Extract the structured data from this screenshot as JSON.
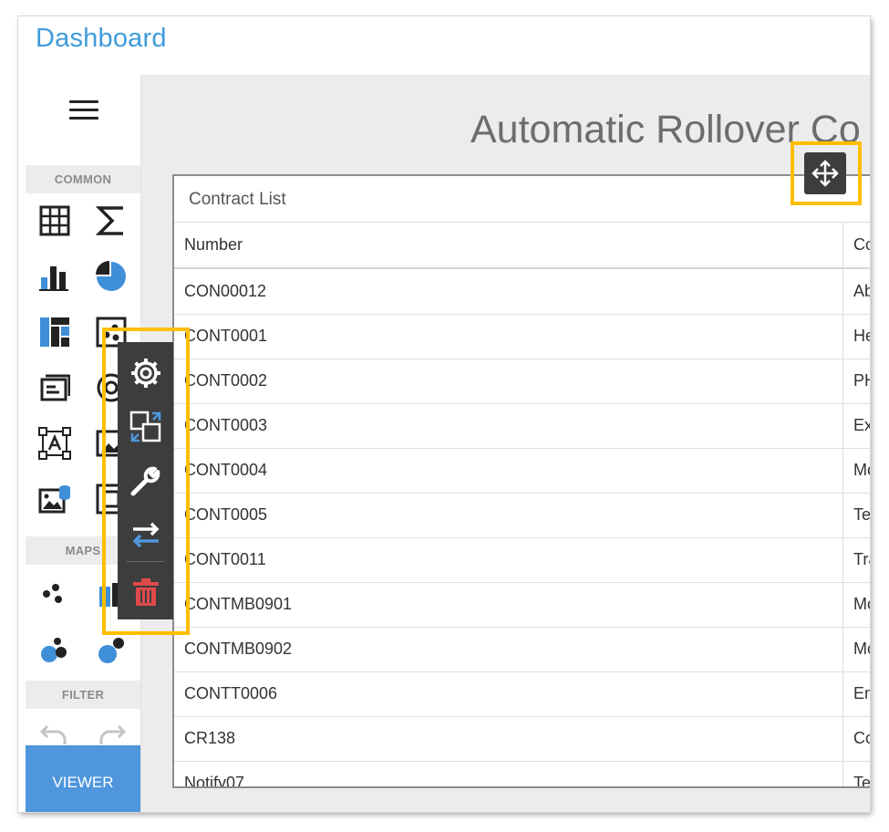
{
  "app": {
    "title": "Dashboard"
  },
  "sidebar": {
    "sections": [
      "COMMON",
      "MAPS",
      "FILTER"
    ],
    "viewer_label": "VIEWER",
    "tools": [
      "grid-icon",
      "sum-icon",
      "bar-chart-icon",
      "pie-chart-icon",
      "treemap-icon",
      "scatter-icon",
      "card-icon",
      "gauge-icon",
      "text-box-icon",
      "image-icon",
      "bound-image-icon",
      "frame-icon",
      "dot-map-icon",
      "choropleth-map-icon",
      "bubble-map-icon",
      "pie-map-icon"
    ]
  },
  "dashboard": {
    "title": "Automatic Rollover Co"
  },
  "grid": {
    "caption": "Contract List",
    "columns": [
      "Number",
      "Co"
    ],
    "rows": [
      {
        "number": "CON00012",
        "col2": "Ab"
      },
      {
        "number": "CONT0001",
        "col2": "He"
      },
      {
        "number": "CONT0002",
        "col2": "PH"
      },
      {
        "number": "CONT0003",
        "col2": "Ex"
      },
      {
        "number": "CONT0004",
        "col2": "Mc"
      },
      {
        "number": "CONT0005",
        "col2": "Te"
      },
      {
        "number": "CONT0011",
        "col2": "Tra"
      },
      {
        "number": "CONTMB0901",
        "col2": "Mc"
      },
      {
        "number": "CONTMB0902",
        "col2": "Mc"
      },
      {
        "number": "CONTT0006",
        "col2": "En"
      },
      {
        "number": "CR138",
        "col2": "Co"
      },
      {
        "number": "Notify07",
        "col2": "Te"
      }
    ]
  },
  "item_menu": {
    "buttons": [
      "gear-icon",
      "convert-icon",
      "wrench-icon",
      "swap-icon",
      "trash-icon"
    ]
  },
  "colors": {
    "accent": "#3f9bdb",
    "viewer": "#4f96dc",
    "highlight": "#ffbe00",
    "delete": "#e04a4a",
    "menu_bg": "#3d3d3d"
  }
}
